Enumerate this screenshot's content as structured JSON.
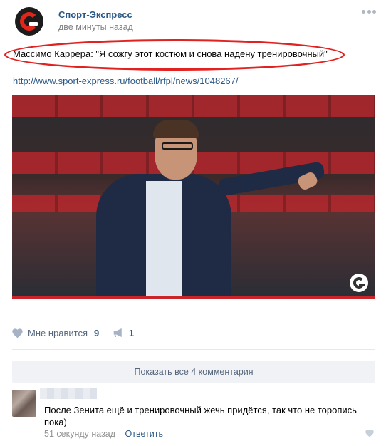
{
  "post": {
    "author": "Спорт-Экспресс",
    "time": "две минуты назад",
    "text": "Массимо Каррера: \"Я сожгу этот костюм и снова надену тренировочный\"",
    "link": "http://www.sport-express.ru/football/rfpl/news/1048267/"
  },
  "actions": {
    "like_label": "Мне нравится",
    "like_count": "9",
    "share_count": "1"
  },
  "comments": {
    "show_all_label": "Показать все 4 комментария",
    "items": [
      {
        "text": "После Зенита ещё и тренировочный жечь придётся, так что не торопись пока)",
        "time": "51 секунду назад",
        "reply_label": "Ответить"
      }
    ]
  },
  "colors": {
    "link": "#2a5885",
    "muted": "#828282",
    "highlight": "#e22121",
    "brand": "#e0261b"
  }
}
